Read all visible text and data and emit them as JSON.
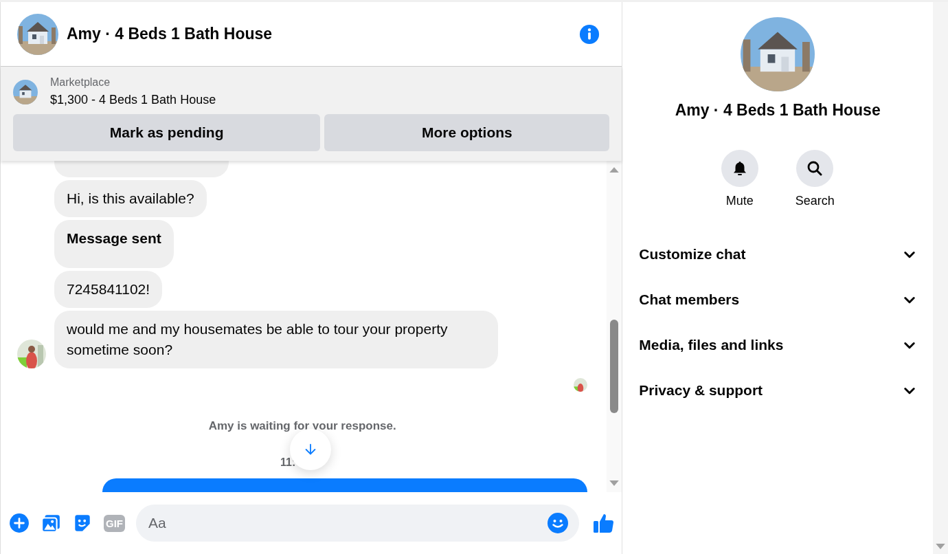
{
  "chat": {
    "title": "Amy · 4 Beds 1 Bath House",
    "listing": {
      "source": "Marketplace",
      "summary": "$1,300 - 4 Beds 1 Bath House"
    },
    "actions": [
      "Mark as pending",
      "More options"
    ],
    "messages": [
      {
        "text": "Hi, is this available?",
        "bold": false,
        "avatar": false
      },
      {
        "text": "Message sent",
        "bold": true,
        "avatar": false
      },
      {
        "text": "7245841102!",
        "bold": false,
        "avatar": false
      },
      {
        "text": "would me and my housemates be able to tour your property sometime soon?",
        "bold": false,
        "avatar": true
      }
    ],
    "notice": "Amy is waiting for your response.",
    "timestamp": "11:",
    "composer": {
      "gif_label": "GIF",
      "placeholder": "Aa"
    }
  },
  "details": {
    "title": "Amy · 4 Beds 1 Bath House",
    "quick_actions": [
      {
        "label": "Mute",
        "kind": "bell"
      },
      {
        "label": "Search",
        "kind": "search"
      }
    ],
    "sections": [
      {
        "label": "Customize chat",
        "expanded": false
      },
      {
        "label": "Chat members",
        "expanded": false
      },
      {
        "label": "Media, files and links",
        "expanded": false
      },
      {
        "label": "Privacy & support",
        "expanded": false
      }
    ]
  }
}
